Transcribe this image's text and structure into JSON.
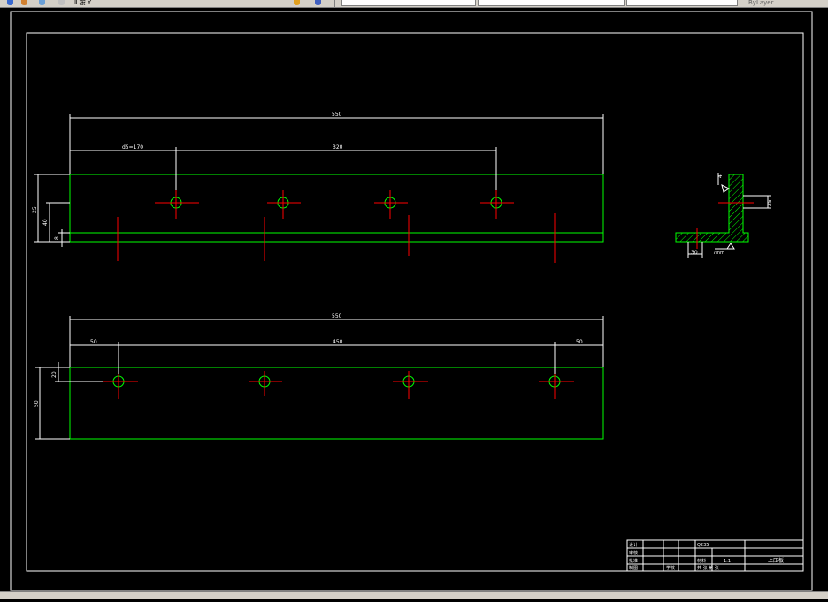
{
  "toolbar": {
    "menu_text": "Ⅱ 按 Y",
    "right_text": "ByLayer"
  },
  "drawing": {
    "top_view": {
      "overall_dim": "550",
      "left_offset_dim": "d5=170",
      "spacing_dim": "320",
      "height_dim_1": "25",
      "height_dim_2": "40",
      "height_dim_3": "8"
    },
    "front_view": {
      "overall_dim": "550",
      "left_dim": "50",
      "middle_dim": "450",
      "right_dim": "50",
      "top_offset_dim": "20",
      "height_dim": "50"
    },
    "section": {
      "label_top": "4",
      "dim_right": "25",
      "dim_bottom": "30",
      "label_bottom": "7mm"
    },
    "title_block": {
      "part_name": "上压板",
      "scale": "1:1",
      "label_design": "设计",
      "label_check": "审核",
      "label_approve": "批准",
      "label_drawing": "制图",
      "label_material": "材料",
      "label_count": "Q235",
      "label_school": "学校",
      "label_sheet": "共 张 第 张"
    }
  },
  "colors": {
    "frame": "#ffffff",
    "outline": "#00ff00",
    "center": "#ff0000",
    "dimension": "#ffffff",
    "hatch": "#00ff00"
  }
}
